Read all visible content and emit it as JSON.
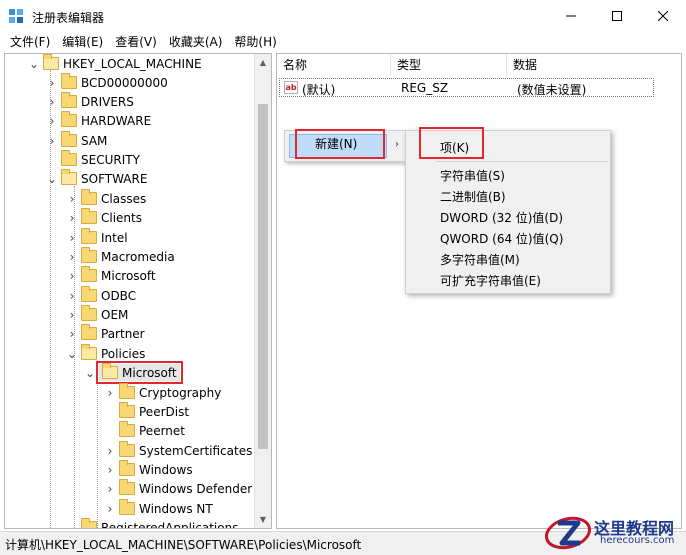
{
  "window": {
    "title": "注册表编辑器",
    "icons": {
      "app": "regedit-icon",
      "minimize": "minimize-icon",
      "maximize": "maximize-icon",
      "close": "close-icon"
    }
  },
  "menu": [
    "文件(F)",
    "编辑(E)",
    "查看(V)",
    "收藏夹(A)",
    "帮助(H)"
  ],
  "tree": {
    "items": [
      "HKEY_LOCAL_MACHINE",
      "BCD00000000",
      "DRIVERS",
      "HARDWARE",
      "SAM",
      "SECURITY",
      "SOFTWARE",
      "Classes",
      "Clients",
      "Intel",
      "Macromedia",
      "Microsoft",
      "ODBC",
      "OEM",
      "Partner",
      "Policies",
      "Microsoft",
      "Cryptography",
      "PeerDist",
      "Peernet",
      "SystemCertificates",
      "Windows",
      "Windows Defender",
      "Windows NT",
      "RegisteredApplications"
    ],
    "selected": "Microsoft"
  },
  "list": {
    "columns": [
      "名称",
      "类型",
      "数据"
    ],
    "rows": [
      {
        "name": "(默认)",
        "type": "REG_SZ",
        "data": "(数值未设置)"
      }
    ]
  },
  "context_menu": {
    "new": "新建(N)",
    "submenu": [
      "项(K)",
      "字符串值(S)",
      "二进制值(B)",
      "DWORD (32 位)值(D)",
      "QWORD (64 位)值(Q)",
      "多字符串值(M)",
      "可扩充字符串值(E)"
    ]
  },
  "status": "计算机\\HKEY_LOCAL_MACHINE\\SOFTWARE\\Policies\\Microsoft",
  "watermark": {
    "title": "这里教程网",
    "url": "herecours.com"
  },
  "colors": {
    "highlight_box": "#e0282e",
    "menu_hover": "#bfdcf8",
    "folder": "#f8d775"
  }
}
